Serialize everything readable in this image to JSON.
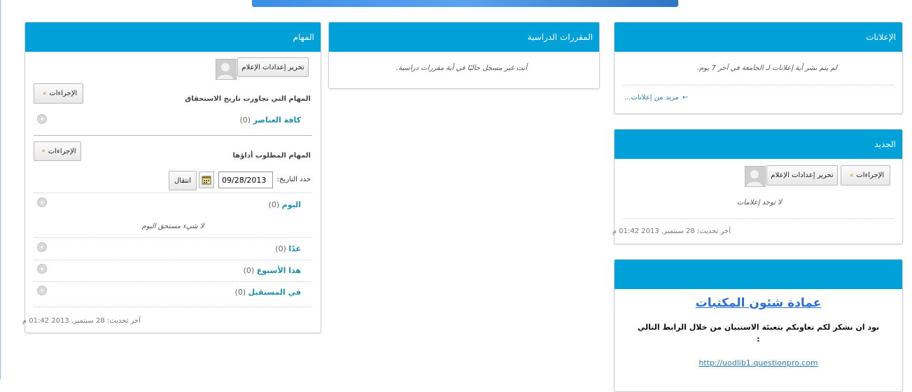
{
  "tasks": {
    "title": "المهام",
    "edit_notifications_label": "تحرير إعدادات الإعلام",
    "overdue": {
      "actions_label": "الإجراءات",
      "heading": "المهام التي تجاوزت تاريخ الاستحقاق",
      "all_items_label": "كافة العناصر",
      "all_items_count": "(0)"
    },
    "due": {
      "actions_label": "الإجراءات",
      "heading": "المهام المطلوب أداؤها",
      "date_label": "حدد التاريخ:",
      "date_value": "09/28/2013",
      "go_label": "انتقال",
      "rows": [
        {
          "label": "اليوم",
          "count": "(0)"
        },
        {
          "label": "غدًا",
          "count": "(0)"
        },
        {
          "label": "هذا الأسبوع",
          "count": "(0)"
        },
        {
          "label": "في المستقبل",
          "count": "(0)"
        }
      ],
      "nothing_due_today": "لا شيء مستحق اليوم"
    },
    "last_updated": "آخر تحديث: 28 سبتمبر, 2013 01:42 م"
  },
  "courses": {
    "title": "المقررات الدراسية",
    "empty_message": "أنت غير مسجل حاليًا في أية مقررات دراسية."
  },
  "announcements": {
    "title": "الإعلانات",
    "empty_message": "لم يتم نشر أية إعلانات لـ الجامعة في آخر 7 يوم.",
    "more_link": "مزيد من إعلانات...",
    "more_arrow": "←"
  },
  "whats_new": {
    "title": "الجديد",
    "actions_label": "الإجراءات",
    "edit_notifications_label": "تحرير إعدادات الإعلام",
    "empty_message": "لا توجد إعلامات",
    "last_updated": "آخر تحديث: 28 سبتمبر, 2013 01:42 م"
  },
  "library": {
    "title_link": "عمادة شئون المكتبات",
    "message": "نود ان نشكر لكم تعاونكم بتعبئة الاستبيان من خلال الرابط التالي",
    "message_colon": ":",
    "url_link": "http://uodlib1.questionpro.com"
  },
  "icons": {
    "actions_chevron": "chevron-double-down-icon",
    "expand": "chevron-down-circle-icon",
    "calendar": "calendar-icon",
    "avatar": "user-avatar-icon"
  },
  "colors": {
    "header": "#00a0d8",
    "link": "#2a7fb1",
    "library_title": "#2a6fd6"
  }
}
